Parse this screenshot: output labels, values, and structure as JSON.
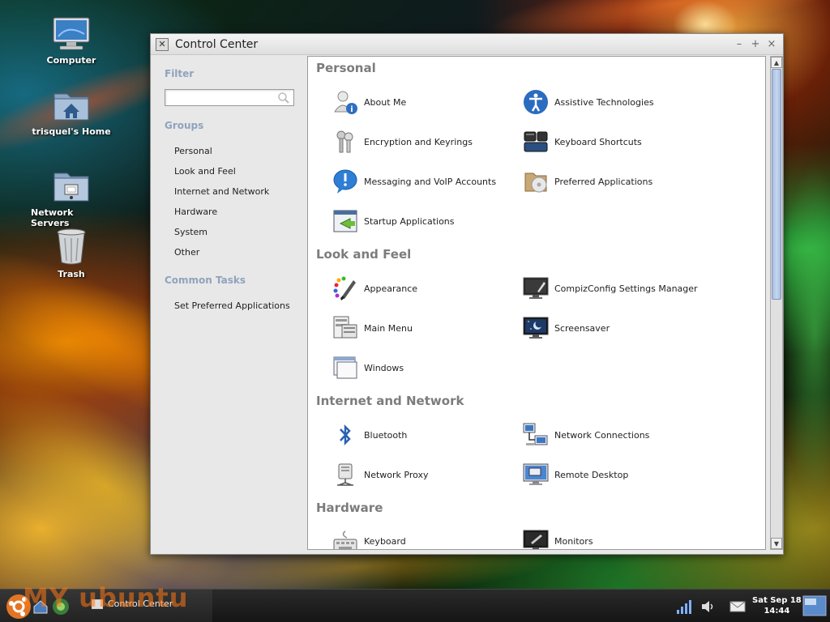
{
  "desktop": {
    "icons": [
      {
        "label": "Computer"
      },
      {
        "label": "trisquel's Home"
      },
      {
        "label": "Network Servers"
      },
      {
        "label": "Trash"
      }
    ]
  },
  "window": {
    "title": "Control Center",
    "controls": {
      "minimize": "–",
      "maximize": "+",
      "close": "×"
    }
  },
  "sidebar": {
    "filter_heading": "Filter",
    "filter_value": "",
    "groups_heading": "Groups",
    "groups": [
      "Personal",
      "Look and Feel",
      "Internet and Network",
      "Hardware",
      "System",
      "Other"
    ],
    "tasks_heading": "Common Tasks",
    "tasks": [
      "Set Preferred Applications"
    ]
  },
  "sections": [
    {
      "heading": "Personal",
      "items": [
        {
          "label": "About Me",
          "icon": "user-info-icon"
        },
        {
          "label": "Assistive Technologies",
          "icon": "accessibility-icon"
        },
        {
          "label": "Encryption and Keyrings",
          "icon": "keys-icon"
        },
        {
          "label": "Keyboard Shortcuts",
          "icon": "keyboard-shortcuts-icon"
        },
        {
          "label": "Messaging and VoIP Accounts",
          "icon": "messaging-icon"
        },
        {
          "label": "Preferred Applications",
          "icon": "preferred-apps-icon"
        },
        {
          "label": "Startup Applications",
          "icon": "startup-icon"
        }
      ]
    },
    {
      "heading": "Look and Feel",
      "items": [
        {
          "label": "Appearance",
          "icon": "paintbrush-icon"
        },
        {
          "label": "CompizConfig Settings Manager",
          "icon": "compiz-icon"
        },
        {
          "label": "Main Menu",
          "icon": "main-menu-icon"
        },
        {
          "label": "Screensaver",
          "icon": "screensaver-icon"
        },
        {
          "label": "Windows",
          "icon": "windows-icon"
        }
      ]
    },
    {
      "heading": "Internet and Network",
      "items": [
        {
          "label": "Bluetooth",
          "icon": "bluetooth-icon"
        },
        {
          "label": "Network Connections",
          "icon": "network-connections-icon"
        },
        {
          "label": "Network Proxy",
          "icon": "network-proxy-icon"
        },
        {
          "label": "Remote Desktop",
          "icon": "remote-desktop-icon"
        }
      ]
    },
    {
      "heading": "Hardware",
      "items": [
        {
          "label": "Keyboard",
          "icon": "keyboard-icon"
        },
        {
          "label": "Monitors",
          "icon": "monitors-icon"
        }
      ]
    }
  ],
  "taskbar": {
    "task_label": "Control Center",
    "watermark": "MY ubuntu",
    "clock_date": "Sat Sep 18",
    "clock_time": "14:44"
  },
  "colors": {
    "group_heading": "#8fa3bd",
    "section_heading": "#7c7c7c",
    "scroll_thumb": "#b4c7e7"
  }
}
